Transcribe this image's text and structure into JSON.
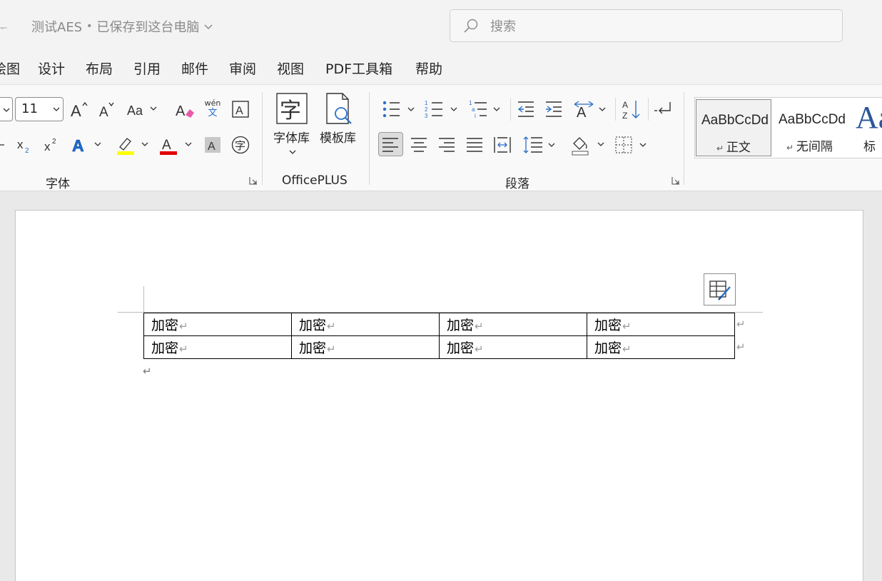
{
  "title_bar": {
    "doc_name": "测试AES",
    "separator": "•",
    "save_status": "已保存到这台电脑",
    "search_placeholder": "搜索"
  },
  "menu_tabs": [
    "绘图",
    "设计",
    "布局",
    "引用",
    "邮件",
    "审阅",
    "视图",
    "PDF工具箱",
    "帮助"
  ],
  "ribbon": {
    "font_size": "11",
    "pinyin_top": "wén",
    "pinyin_bottom": "文",
    "group_font": "字体",
    "group_officeplus": "OfficePLUS",
    "group_paragraph": "段落",
    "font_library": "字体库",
    "template_library": "模板库",
    "font_lib_glyph": "字",
    "encircle_glyph": "字",
    "colors": {
      "highlight": "#ffff00",
      "font_color": "#e00000",
      "text_effect": "#1e6fd8",
      "accent": "#2b579a"
    }
  },
  "styles_gallery": {
    "items": [
      {
        "sample": "AaBbCcDd",
        "name": "正文",
        "selected": true
      },
      {
        "sample": "AaBbCcDd",
        "name": "无间隔",
        "selected": false
      },
      {
        "sample": "Aa",
        "name": "标",
        "selected": false
      }
    ]
  },
  "document": {
    "table": [
      [
        "加密",
        "加密",
        "加密",
        "加密"
      ],
      [
        "加密",
        "加密",
        "加密",
        "加密"
      ]
    ],
    "paragraph_mark": "↵",
    "end_of_row_mark": "↵"
  }
}
